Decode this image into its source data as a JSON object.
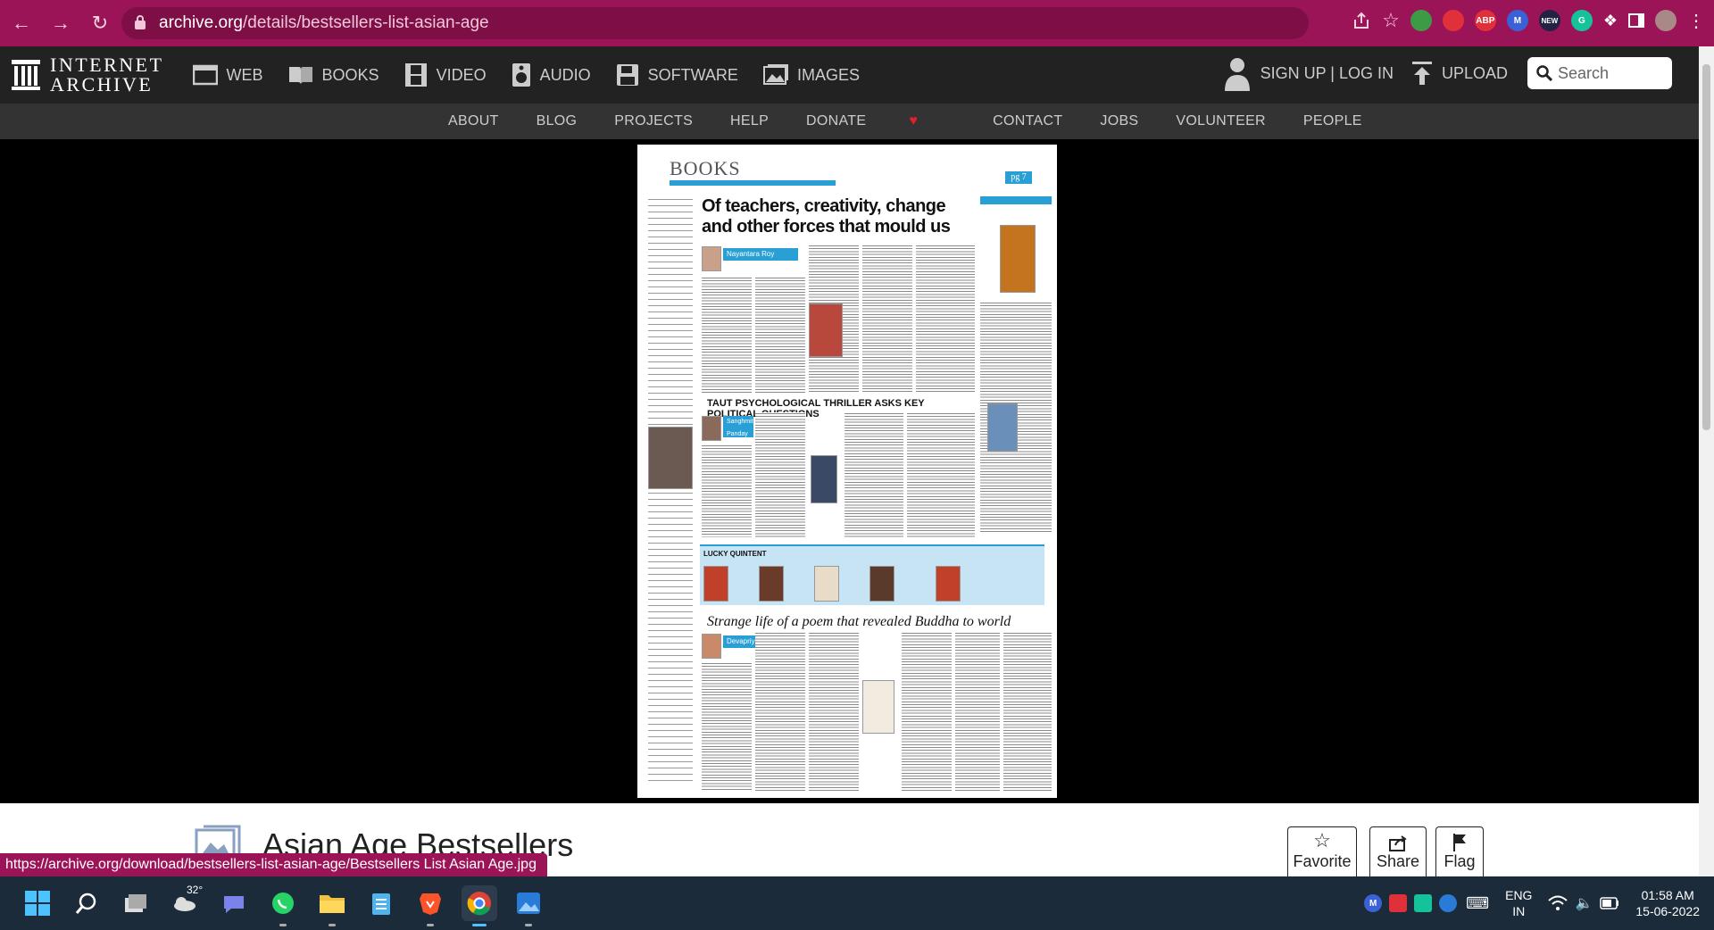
{
  "browser": {
    "url_domain": "archive.org",
    "url_path": "/details/bestsellers-list-asian-age",
    "status_url": "https://archive.org/download/bestsellers-list-asian-age/Bestsellers List Asian Age.jpg",
    "extensions": [
      "ABP",
      "NEW"
    ],
    "colors": {
      "chrome": "#9c1458",
      "omnibox": "#7d0f46"
    }
  },
  "ia": {
    "logo_line1": "INTERNET",
    "logo_line2": "ARCHIVE",
    "media": [
      {
        "label": "WEB",
        "icon": "web-icon"
      },
      {
        "label": "BOOKS",
        "icon": "books-icon"
      },
      {
        "label": "VIDEO",
        "icon": "film-icon"
      },
      {
        "label": "AUDIO",
        "icon": "speaker-icon"
      },
      {
        "label": "SOFTWARE",
        "icon": "floppy-icon"
      },
      {
        "label": "IMAGES",
        "icon": "image-icon"
      }
    ],
    "signup": "SIGN UP | LOG IN",
    "upload": "UPLOAD",
    "search_placeholder": "Search",
    "subnav": [
      "ABOUT",
      "BLOG",
      "PROJECTS",
      "HELP",
      "DONATE",
      "CONTACT",
      "JOBS",
      "VOLUNTEER",
      "PEOPLE"
    ]
  },
  "newspaper": {
    "section": "BOOKS",
    "page": "pg 7",
    "headline1": "Of teachers, creativity, change and other forces that mould us",
    "headline2": "TAUT PSYCHOLOGICAL THRILLER ASKS KEY POLITICAL QUESTIONS",
    "quintet": "LUCKY QUINTENT",
    "headline3": "Strange life of a poem that revealed Buddha to world",
    "byline1": "Nayantara Roy",
    "byline2": "Sanghmitra Panday",
    "byline3": "Devapriya Roy"
  },
  "details": {
    "title": "Asian Age Bestsellers",
    "favorite": "Favorite",
    "share": "Share",
    "flag": "Flag"
  },
  "taskbar": {
    "weather": "32°",
    "lang1": "ENG",
    "lang2": "IN",
    "time": "01:58 AM",
    "date": "15-06-2022"
  }
}
